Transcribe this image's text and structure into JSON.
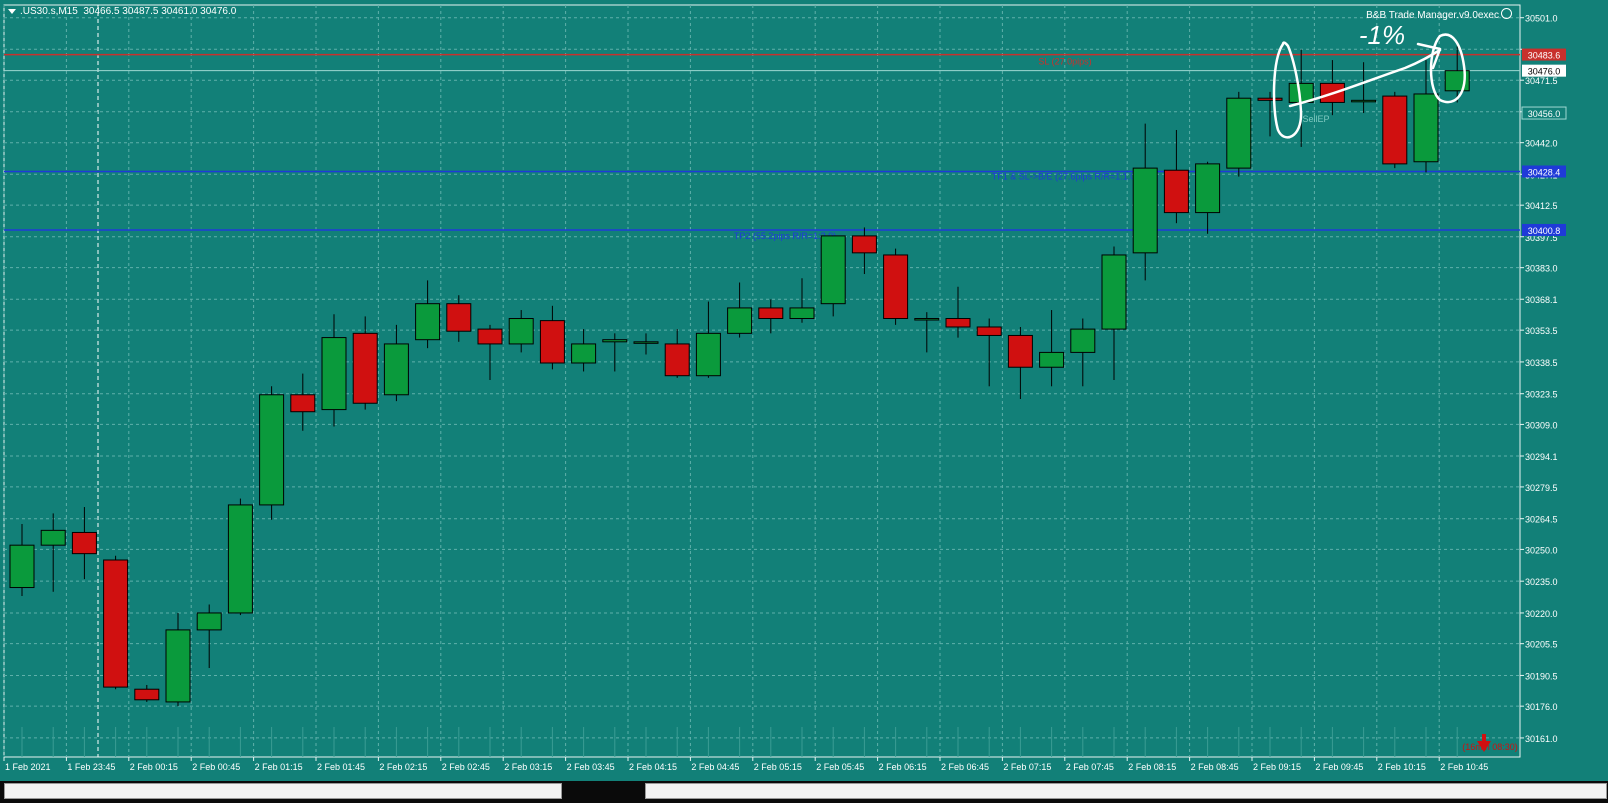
{
  "symbol_header": {
    "symbol": ".US30.s,M15",
    "ohlc": "30466.5 30487.5 30461.0 30476.0"
  },
  "expert": {
    "name": "B&B Trade Manager.v9.0exec"
  },
  "colors": {
    "background": "#128078",
    "grid": "#5fb0aa",
    "bull": "#0a9a3c",
    "bear": "#d01010",
    "sl_line": "#c8302c",
    "tp_line": "#1f3ad8",
    "text": "#ffffff"
  },
  "timer": "(16min 08:30)",
  "annotation": "-1%",
  "chart_data": {
    "type": "candlestick",
    "timeframe": "M15",
    "ylim": [
      30152.0,
      30507.0
    ],
    "y_ticks": [
      30501.0,
      30486.1,
      30471.5,
      30456.6,
      30442.0,
      30427.1,
      30412.5,
      30397.6,
      30383.0,
      30368.1,
      30353.5,
      30338.5,
      30323.5,
      30309.0,
      30294.1,
      30279.5,
      30264.5,
      30250.0,
      30235.0,
      30220.0,
      30205.5,
      30190.5,
      30176.0,
      30161.0
    ],
    "y_tick_labels": [
      "30501.0",
      "30471.5",
      "30442.0",
      "30427.1",
      "30412.5",
      "30397.5",
      "30383.0",
      "30368.1",
      "30353.5",
      "30338.5",
      "30323.5",
      "30309.0",
      "30294.1",
      "30279.5",
      "30264.5",
      "30250.0",
      "30235.0",
      "30220.0",
      "30205.5",
      "30190.5",
      "30176.0",
      "30161.0"
    ],
    "x_labels": [
      "1 Feb 2021",
      "1 Feb 23:45",
      "2 Feb 00:15",
      "2 Feb 00:45",
      "2 Feb 01:15",
      "2 Feb 01:45",
      "2 Feb 02:15",
      "2 Feb 02:45",
      "2 Feb 03:15",
      "2 Feb 03:45",
      "2 Feb 04:15",
      "2 Feb 04:45",
      "2 Feb 05:15",
      "2 Feb 05:45",
      "2 Feb 06:15",
      "2 Feb 06:45",
      "2 Feb 07:15",
      "2 Feb 07:45",
      "2 Feb 08:15",
      "2 Feb 08:45",
      "2 Feb 09:15",
      "2 Feb 09:45",
      "2 Feb 10:15",
      "2 Feb 10:45"
    ],
    "candles": [
      {
        "o": 30232,
        "h": 30262,
        "l": 30228,
        "c": 30252
      },
      {
        "o": 30252,
        "h": 30267,
        "l": 30230,
        "c": 30259
      },
      {
        "o": 30258,
        "h": 30270,
        "l": 30236,
        "c": 30248
      },
      {
        "o": 30245,
        "h": 30247,
        "l": 30184,
        "c": 30185
      },
      {
        "o": 30184,
        "h": 30186,
        "l": 30178,
        "c": 30179
      },
      {
        "o": 30178,
        "h": 30220,
        "l": 30176,
        "c": 30212
      },
      {
        "o": 30212,
        "h": 30224,
        "l": 30194,
        "c": 30220
      },
      {
        "o": 30220,
        "h": 30274,
        "l": 30219,
        "c": 30271
      },
      {
        "o": 30271,
        "h": 30327,
        "l": 30264,
        "c": 30323
      },
      {
        "o": 30323,
        "h": 30333,
        "l": 30306,
        "c": 30315
      },
      {
        "o": 30316,
        "h": 30361,
        "l": 30308,
        "c": 30350
      },
      {
        "o": 30352,
        "h": 30360,
        "l": 30316,
        "c": 30319
      },
      {
        "o": 30323,
        "h": 30356,
        "l": 30320,
        "c": 30347
      },
      {
        "o": 30349,
        "h": 30377,
        "l": 30345,
        "c": 30366
      },
      {
        "o": 30366,
        "h": 30370,
        "l": 30348,
        "c": 30353
      },
      {
        "o": 30354,
        "h": 30356,
        "l": 30330,
        "c": 30347
      },
      {
        "o": 30347,
        "h": 30363,
        "l": 30343,
        "c": 30359
      },
      {
        "o": 30358,
        "h": 30365,
        "l": 30335,
        "c": 30338
      },
      {
        "o": 30338,
        "h": 30354,
        "l": 30334,
        "c": 30347
      },
      {
        "o": 30348,
        "h": 30352,
        "l": 30334,
        "c": 30349
      },
      {
        "o": 30348,
        "h": 30352,
        "l": 30342,
        "c": 30348
      },
      {
        "o": 30347,
        "h": 30354,
        "l": 30331,
        "c": 30332
      },
      {
        "o": 30332,
        "h": 30367,
        "l": 30331,
        "c": 30352
      },
      {
        "o": 30352,
        "h": 30376,
        "l": 30350,
        "c": 30364
      },
      {
        "o": 30364,
        "h": 30368,
        "l": 30352,
        "c": 30359
      },
      {
        "o": 30359,
        "h": 30378,
        "l": 30357,
        "c": 30364
      },
      {
        "o": 30366,
        "h": 30397,
        "l": 30360,
        "c": 30398
      },
      {
        "o": 30398,
        "h": 30402,
        "l": 30380,
        "c": 30390
      },
      {
        "o": 30389,
        "h": 30392,
        "l": 30356,
        "c": 30359
      },
      {
        "o": 30359,
        "h": 30362,
        "l": 30343,
        "c": 30359
      },
      {
        "o": 30359,
        "h": 30374,
        "l": 30350,
        "c": 30355
      },
      {
        "o": 30355,
        "h": 30359,
        "l": 30327,
        "c": 30351
      },
      {
        "o": 30351,
        "h": 30355,
        "l": 30321,
        "c": 30336
      },
      {
        "o": 30336,
        "h": 30363,
        "l": 30327,
        "c": 30343
      },
      {
        "o": 30343,
        "h": 30359,
        "l": 30327,
        "c": 30354
      },
      {
        "o": 30354,
        "h": 30393,
        "l": 30330,
        "c": 30389
      },
      {
        "o": 30390,
        "h": 30451,
        "l": 30377,
        "c": 30430
      },
      {
        "o": 30429,
        "h": 30448,
        "l": 30404,
        "c": 30409
      },
      {
        "o": 30409,
        "h": 30433,
        "l": 30399,
        "c": 30432
      },
      {
        "o": 30430,
        "h": 30466,
        "l": 30426,
        "c": 30463
      },
      {
        "o": 30463,
        "h": 30466,
        "l": 30445,
        "c": 30462
      },
      {
        "o": 30461,
        "h": 30486,
        "l": 30440,
        "c": 30470
      },
      {
        "o": 30470,
        "h": 30481,
        "l": 30455,
        "c": 30461
      },
      {
        "o": 30462,
        "h": 30480,
        "l": 30456,
        "c": 30462
      },
      {
        "o": 30464,
        "h": 30466,
        "l": 30430,
        "c": 30432
      },
      {
        "o": 30433,
        "h": 30481,
        "l": 30428,
        "c": 30465
      },
      {
        "o": 30466.5,
        "h": 30487.5,
        "l": 30461,
        "c": 30476
      }
    ],
    "price_levels": [
      {
        "name": "sl",
        "price": 30483.6,
        "label": "SL (27.0pips)",
        "color": "#c8302c"
      },
      {
        "name": "entry",
        "price": 30456.0,
        "label": "SellEP",
        "color": "#7ec8c0"
      },
      {
        "name": "tp1",
        "price": 30428.4,
        "label": "TF1 & SL->B/E (27.6pips R/R=1:1.0)",
        "color": "#1f3ad8"
      },
      {
        "name": "tp2",
        "price": 30400.8,
        "label": "TP2 (55.2pips R/R=1:2.0)",
        "color": "#1f3ad8"
      },
      {
        "name": "bid",
        "price": 30476.0,
        "label": "30476.0",
        "color": "#ffffff"
      }
    ],
    "price_level_tags": [
      "30483.6",
      "30456.0",
      "30428.4",
      "30400.8",
      "30476.0"
    ],
    "grid": true
  }
}
